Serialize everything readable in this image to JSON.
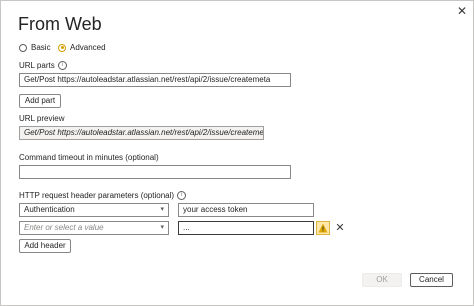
{
  "dialog": {
    "title": "From Web",
    "close_glyph": "✕"
  },
  "mode": {
    "basic_label": "Basic",
    "advanced_label": "Advanced",
    "selected": "Advanced"
  },
  "url_parts": {
    "label": "URL parts",
    "info_glyph": "i",
    "value": "Get/Post https://autoleadstar.atlassian.net/rest/api/2/issue/createmeta",
    "add_part_label": "Add part"
  },
  "url_preview": {
    "label": "URL preview",
    "value": "Get/Post https://autoleadstar.atlassian.net/rest/api/2/issue/createmeta"
  },
  "timeout": {
    "label": "Command timeout in minutes (optional)",
    "value": ""
  },
  "headers": {
    "label": "HTTP request header parameters (optional)",
    "info_glyph": "i",
    "rows": [
      {
        "name": "Authentication",
        "name_placeholder": "",
        "value": "your access token"
      },
      {
        "name": "",
        "name_placeholder": "Enter or select a value",
        "value": "..."
      }
    ],
    "add_header_label": "Add header",
    "warning_icon": "warning-icon",
    "delete_glyph": "✕"
  },
  "footer": {
    "ok_label": "OK",
    "cancel_label": "Cancel"
  },
  "colors": {
    "accent": "#d6a000",
    "warning_bg": "#fde7a9"
  }
}
